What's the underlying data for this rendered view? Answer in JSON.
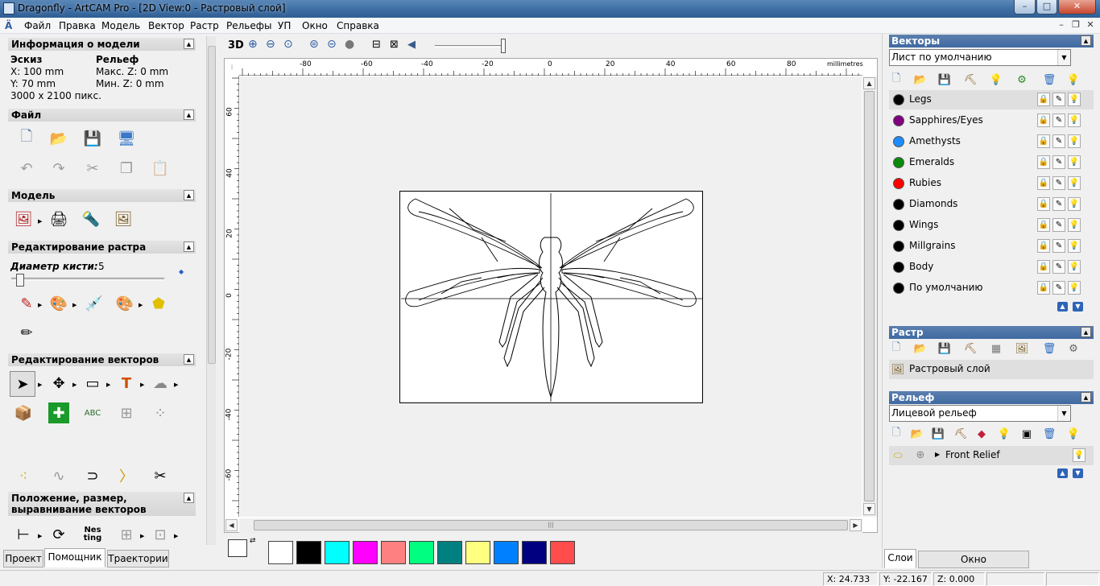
{
  "window": {
    "title": "Dragonfly - ArtCAM Pro - [2D View:0 - Растровый слой]",
    "min": "–",
    "max": "□",
    "close": "✕"
  },
  "menu": [
    "Файл",
    "Правка",
    "Модель",
    "Вектор",
    "Растр",
    "Рельефы",
    "УП",
    "Окно",
    "Справка"
  ],
  "mdi": {
    "min": "–",
    "restore": "❐",
    "close": "✕"
  },
  "left": {
    "model_info": {
      "title": "Информация о модели",
      "sketch": "Эскиз",
      "relief": "Рельеф",
      "x": "X: 100 mm",
      "y": "Y: 70 mm",
      "max_z": "Макс. Z: 0 mm",
      "min_z": "Мин. Z: 0 mm",
      "pixels": "3000 x 2100 пикс."
    },
    "file_title": "Файл",
    "model_title": "Модель",
    "raster_edit_title": "Редактирование растра",
    "brush_label": "Диаметр кисти:",
    "brush_value": "5",
    "brush_fraction": 0.06,
    "vector_edit_title": "Редактирование векторов",
    "position_title": "Положение, размер, выравнивание векторов",
    "nesting_text": "Nes ting",
    "tabs": [
      "Проект",
      "Помощник",
      "Траектории"
    ]
  },
  "view": {
    "mode_label": "3D",
    "units": "millimetres",
    "h_ticks": [
      "-80",
      "-60",
      "-40",
      "-20",
      "0",
      "20",
      "40",
      "60",
      "80"
    ],
    "v_ticks": [
      "60",
      "40",
      "20",
      "0",
      "-20",
      "-40",
      "-60"
    ]
  },
  "palette": {
    "fg": "#ffffff",
    "bg": "#000000",
    "colors": [
      "#ffffff",
      "#000000",
      "#00ffff",
      "#ff00ff",
      "#ff8080",
      "#00ff80",
      "#008080",
      "#ffff80",
      "#0080ff",
      "#000080",
      "#ff4d4d"
    ]
  },
  "right": {
    "vectors_title": "Векторы",
    "sheet": "Лист по умолчанию",
    "layers": [
      {
        "name": "Legs",
        "color": "#000000"
      },
      {
        "name": "Sapphires/Eyes",
        "color": "#800080"
      },
      {
        "name": "Amethysts",
        "color": "#1e8cff"
      },
      {
        "name": "Emeralds",
        "color": "#0a8a0a"
      },
      {
        "name": "Rubies",
        "color": "#ff0000"
      },
      {
        "name": "Diamonds",
        "color": "#000000"
      },
      {
        "name": "Wings",
        "color": "#000000"
      },
      {
        "name": "Millgrains",
        "color": "#000000"
      },
      {
        "name": "Body",
        "color": "#000000"
      },
      {
        "name": "По умолчанию",
        "color": "#000000"
      }
    ],
    "raster_title": "Растр",
    "raster_layer": "Растровый слой",
    "relief_title": "Рельеф",
    "relief_combo": "Лицевой рельеф",
    "relief_layer": "Front Relief",
    "tabs": [
      "Слои",
      "Окно инструментария"
    ]
  },
  "status": {
    "x": "X: 24.733",
    "y": "Y: -22.167",
    "z": "Z: 0.000"
  }
}
